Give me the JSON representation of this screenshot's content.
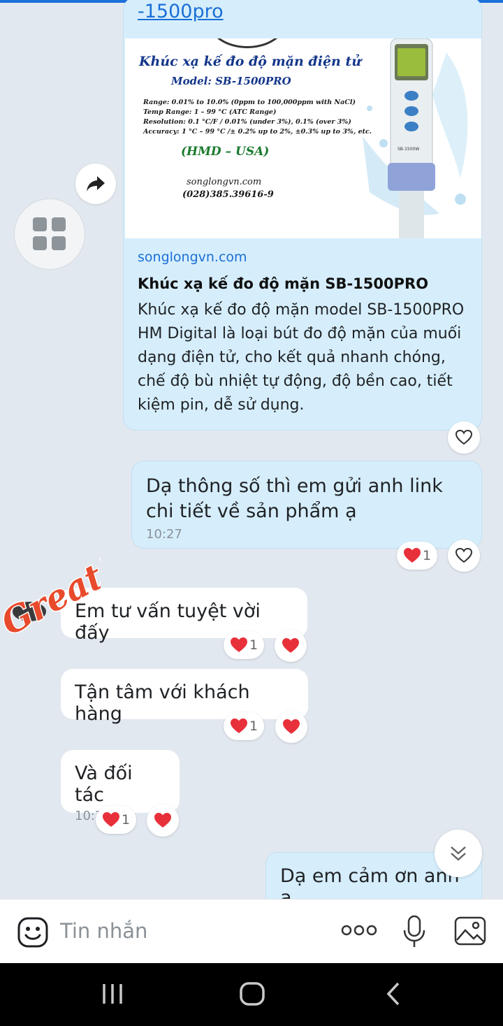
{
  "link_preview": {
    "url_tail": "-1500pro",
    "image": {
      "title": "Khúc xạ kế đo độ mặn điện tử",
      "model": "Model: SB-1500PRO",
      "specs": [
        "Range: 0.01% to 10.0% (0ppm to 100,000ppm with NaCl)",
        "Temp Range: 1 – 99 °C (ATC Range)",
        "Resolution: 0.1 °C/F / 0.01% (under 3%), 0.1% (over 3%)",
        "Accuracy: 1 °C – 99 °C /± 0.2% up to 2%, ±0.3% up to 3%, etc."
      ],
      "brand": "(HMD – USA)",
      "site": "songlongvn.com",
      "phone": "(028)385.39616-9",
      "device_label": "SB-1500W"
    },
    "domain": "songlongvn.com",
    "title": "Khúc xạ kế đo độ mặn SB-1500PRO",
    "description": "Khúc xạ kế đo độ mặn model SB-1500PRO HM Digital là loại bút đo độ mặn của muối dạng điện tử, cho kết quả nhanh chóng, chế độ bù nhiệt tự động, độ bền cao, tiết kiệm pin, dễ sử dụng."
  },
  "messages": [
    {
      "id": "m1",
      "direction": "out",
      "text": "Dạ thông số thì em gửi anh link chi tiết về sản phẩm ạ",
      "time": "10:27",
      "reaction_count": "1"
    },
    {
      "id": "m2",
      "direction": "in",
      "text": "Em tư vấn tuyệt vời đấy",
      "reaction_count": "1"
    },
    {
      "id": "m3",
      "direction": "in",
      "text": "Tận tâm với khách hàng",
      "reaction_count": "1"
    },
    {
      "id": "m4",
      "direction": "in",
      "text": "Và đối tác",
      "time": "10:28",
      "reaction_count": "1"
    },
    {
      "id": "m5",
      "direction": "out",
      "text": "Dạ em cảm ơn anh ạ"
    }
  ],
  "sticker_text": "Great!",
  "composer": {
    "placeholder": "Tin nhắn"
  },
  "colors": {
    "outgoing_bubble": "#d6eefc",
    "incoming_bubble": "#ffffff",
    "background": "#e2e8ef",
    "link": "#1b6fd6",
    "heart": "#e8303a"
  },
  "icons": [
    "share-icon",
    "grid-icon",
    "heart-outline-icon",
    "heart-icon",
    "chevron-double-down-icon",
    "emoji-icon",
    "more-dots-icon",
    "mic-icon",
    "image-icon",
    "nav-recents-icon",
    "nav-home-icon",
    "nav-back-icon"
  ]
}
